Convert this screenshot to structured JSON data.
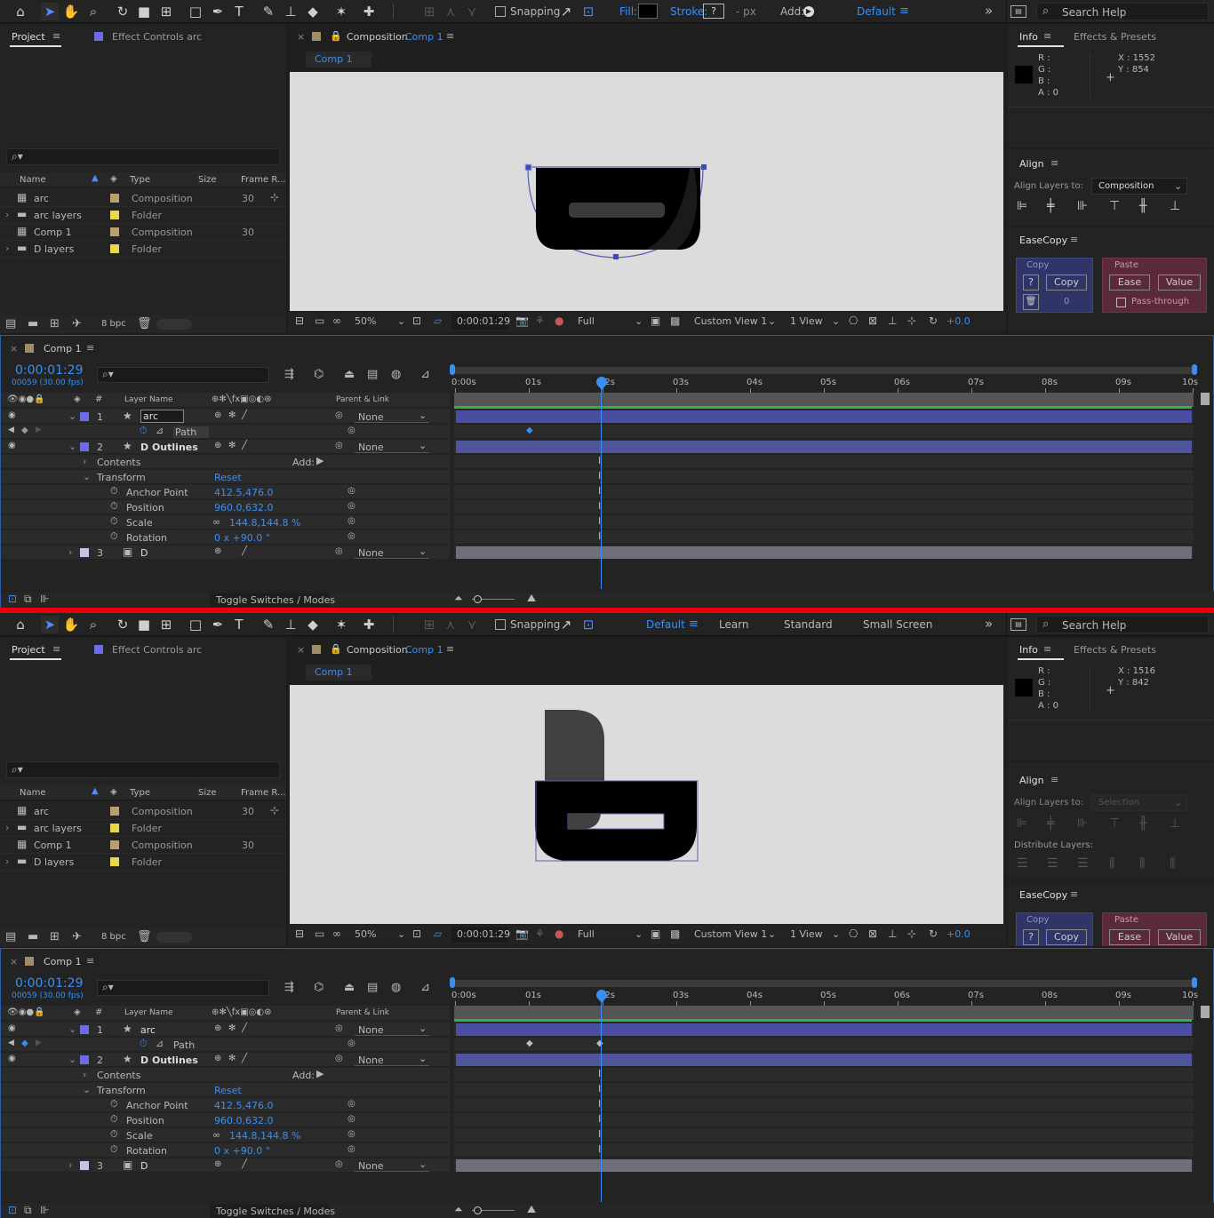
{
  "toolbar": {
    "snapping_label": "Snapping",
    "fill_label": "Fill:",
    "stroke_label": "Stroke:",
    "stroke_value": "?",
    "px_label": "- px",
    "add_label": "Add:",
    "search_help": "Search Help",
    "workspace_top": "Default",
    "workspaces_bottom": [
      "Default",
      "Learn",
      "Standard",
      "Small Screen"
    ]
  },
  "project": {
    "tab_label": "Project",
    "effect_controls_label": "Effect Controls arc",
    "columns": [
      "Name",
      "Type",
      "Size",
      "Frame R..."
    ],
    "items": [
      {
        "name": "arc",
        "type": "Composition",
        "frame": "30",
        "color": "#b79f6e"
      },
      {
        "name": "arc layers",
        "type": "Folder",
        "frame": "",
        "color": "#e8d94b"
      },
      {
        "name": "Comp 1",
        "type": "Composition",
        "frame": "30",
        "color": "#b79f6e"
      },
      {
        "name": "D layers",
        "type": "Folder",
        "frame": "",
        "color": "#e8d94b"
      }
    ],
    "bpc": "8 bpc"
  },
  "composition": {
    "tab_prefix": "Composition",
    "tab_name": "Comp 1",
    "subtab": "Comp 1",
    "zoom": "50%",
    "timecode": "0:00:01:29",
    "resolution": "Full",
    "view": "Custom View 1",
    "views": "1 View",
    "exposure": "+0.0"
  },
  "info": {
    "tab_label": "Info",
    "effects_tab": "Effects & Presets",
    "channels": [
      "R :",
      "G :",
      "B :",
      "A :  0"
    ],
    "top_x": "X : 1552",
    "top_y": "Y : 854",
    "bottom_x": "X : 1516",
    "bottom_y": "Y : 842"
  },
  "align": {
    "title": "Align",
    "align_to_label": "Align Layers to:",
    "align_to_top": "Composition",
    "align_to_bottom": "Selection",
    "distribute_label": "Distribute Layers:"
  },
  "easecopy": {
    "title": "EaseCopy",
    "copy_group": "Copy",
    "paste_group": "Paste",
    "help_btn": "?",
    "copy_btn": "Copy",
    "ease_btn": "Ease",
    "value_btn": "Value",
    "count": "0",
    "pass_through": "Pass-through"
  },
  "timeline": {
    "tab_label": "Comp 1",
    "timecode": "0:00:01:29",
    "frames": "00059 (30.00 fps)",
    "layer_name_col": "Layer Name",
    "parent_col": "Parent & Link",
    "ruler": [
      "0:00s",
      "01s",
      "02s",
      "03s",
      "04s",
      "05s",
      "06s",
      "07s",
      "08s",
      "09s",
      "10s"
    ],
    "layers": [
      {
        "num": "1",
        "name": "arc",
        "parent": "None"
      },
      {
        "num": "2",
        "name": "D Outlines",
        "parent": "None"
      },
      {
        "num": "3",
        "name": "D",
        "parent": "None"
      }
    ],
    "path_label": "Path",
    "contents_label": "Contents",
    "add_label": "Add:",
    "transform_label": "Transform",
    "reset_label": "Reset",
    "props": [
      {
        "name": "Anchor Point",
        "value": "412.5,476.0"
      },
      {
        "name": "Position",
        "value": "960.0,632.0"
      },
      {
        "name": "Scale",
        "value": "144.8,144.8 %"
      },
      {
        "name": "Rotation",
        "value": "0 x +90.0 °"
      }
    ],
    "toggle_label": "Toggle Switches / Modes"
  }
}
